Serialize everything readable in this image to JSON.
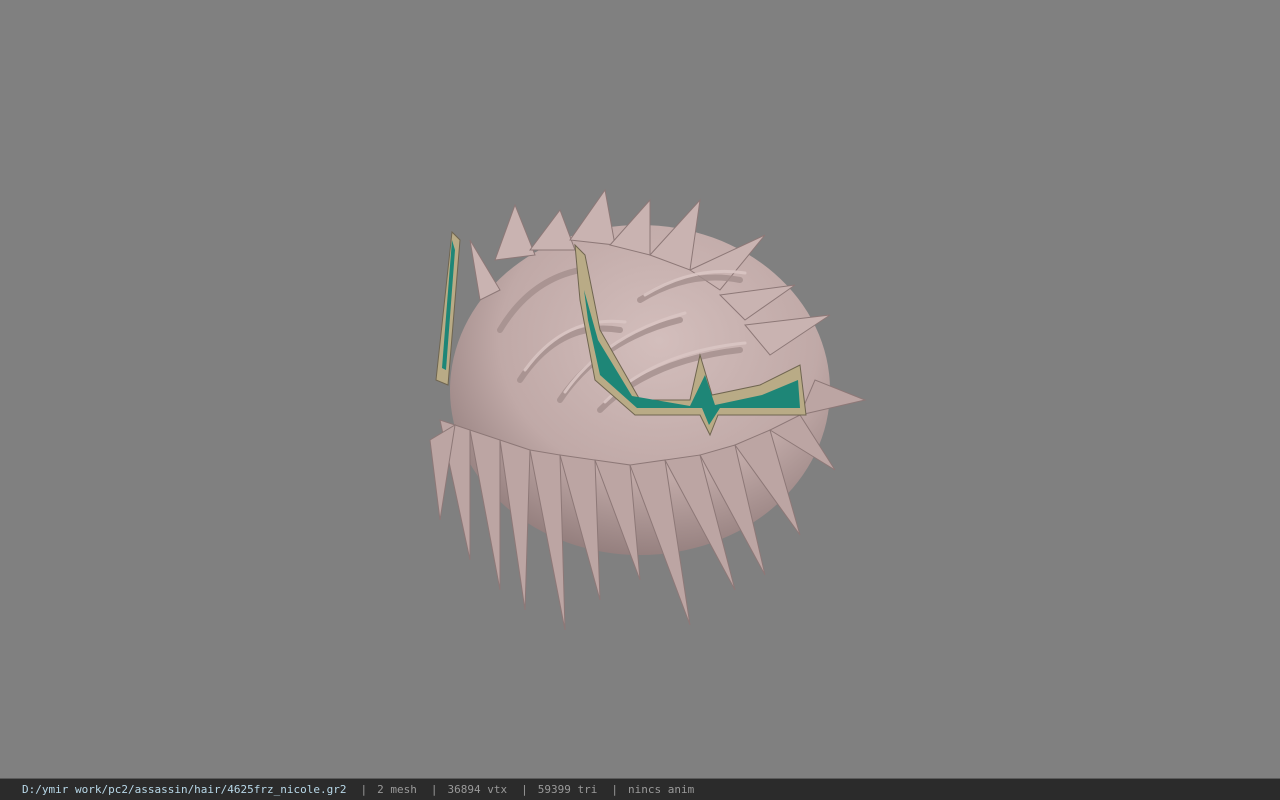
{
  "viewport": {
    "background_color": "#808080",
    "model": {
      "icon": "hair-mesh-model",
      "hair_color": "#c4aeac",
      "hair_shadow_color": "#8d7877",
      "crown_gold_color": "#b9ab86",
      "crown_gem_color": "#1e8677"
    }
  },
  "status_bar": {
    "file_path": "D:/ymir work/pc2/assassin/hair/4625frz_nicole.gr2",
    "separator": "|",
    "mesh_count": "2 mesh",
    "vertex_count": "36894 vtx",
    "triangle_count": "59399 tri",
    "anim_status": "nincs anim"
  }
}
